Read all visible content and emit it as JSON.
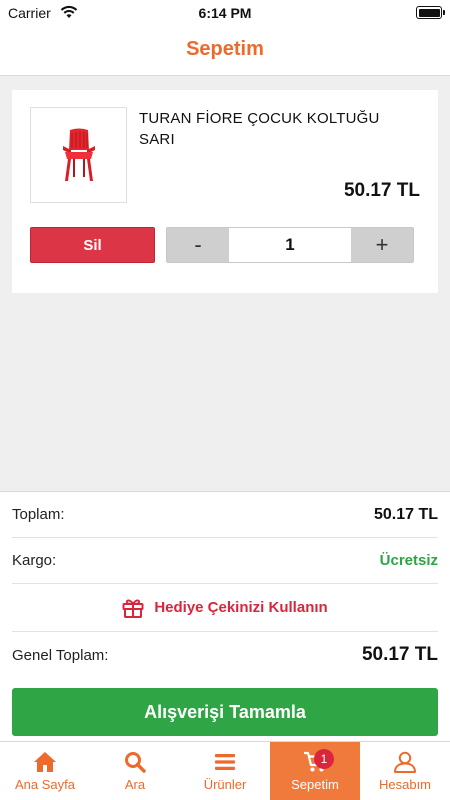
{
  "status_bar": {
    "carrier": "Carrier",
    "time": "6:14 PM"
  },
  "nav": {
    "title": "Sepetim"
  },
  "cart": {
    "items": [
      {
        "name": "TURAN FİORE ÇOCUK KOLTUĞU SARI",
        "price": "50.17 TL",
        "remove_label": "Sil",
        "decrement_label": "-",
        "quantity": "1",
        "increment_label": "+",
        "image_icon": "red-plastic-chair"
      }
    ]
  },
  "summary": {
    "subtotal_label": "Toplam:",
    "subtotal_value": "50.17 TL",
    "shipping_label": "Kargo:",
    "shipping_value": "Ücretsiz",
    "gift_label": "Hediye Çekinizi Kullanın",
    "grand_total_label": "Genel Toplam:",
    "grand_total_value": "50.17 TL",
    "checkout_label": "Alışverişi Tamamla"
  },
  "tabs": [
    {
      "label": "Ana Sayfa",
      "icon": "home-icon",
      "active": false
    },
    {
      "label": "Ara",
      "icon": "search-icon",
      "active": false
    },
    {
      "label": "Ürünler",
      "icon": "menu-icon",
      "active": false
    },
    {
      "label": "Sepetim",
      "icon": "cart-icon",
      "active": true,
      "badge": "1"
    },
    {
      "label": "Hesabım",
      "icon": "user-icon",
      "active": false
    }
  ],
  "colors": {
    "brand": "#ee6a2c",
    "danger": "#dc3545",
    "success": "#30a545",
    "gift": "#d9263b"
  }
}
